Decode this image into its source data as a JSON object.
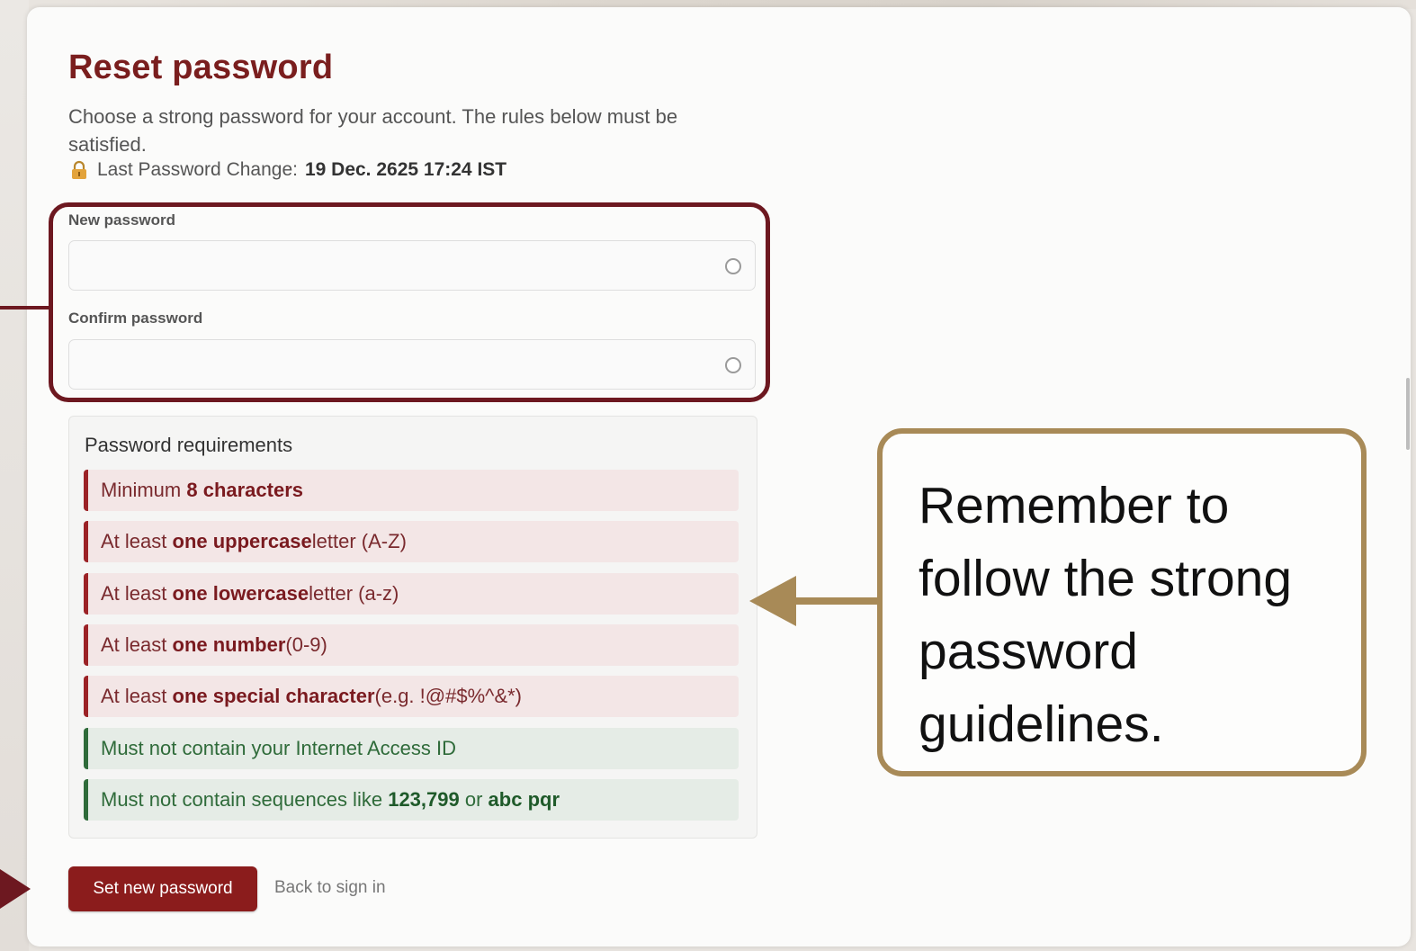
{
  "page": {
    "title": "Reset password",
    "subtitle": "Choose a strong password for your account. The rules below must be satisfied.",
    "last_change_label": "Last Password Change:",
    "last_change_value": "19 Dec. 2625 17:24 IST"
  },
  "form": {
    "new_password_label": "New password",
    "new_password_value": "",
    "confirm_password_label": "Confirm password",
    "confirm_password_value": ""
  },
  "requirements": {
    "heading": "Password requirements",
    "items": [
      {
        "status": "fail",
        "pre": "Minimum ",
        "bold": "8 characters",
        "post": ""
      },
      {
        "status": "fail",
        "pre": "At least ",
        "bold": "one uppercase",
        "post": " letter (A-Z)"
      },
      {
        "status": "fail",
        "pre": "At least ",
        "bold": "one lowercase",
        "post": " letter (a-z)"
      },
      {
        "status": "fail",
        "pre": "At least ",
        "bold": "one number",
        "post": " (0-9)"
      },
      {
        "status": "fail",
        "pre": "At least ",
        "bold": "one special character",
        "post": " (e.g. !@#$%^&*)"
      },
      {
        "status": "pass",
        "pre": "Must not contain your Internet Access ID",
        "bold": "",
        "post": ""
      },
      {
        "status": "pass",
        "pre": "Must not contain sequences like ",
        "bold": "123,799",
        "post": " or ",
        "bold2": "abc pqr"
      }
    ]
  },
  "actions": {
    "submit_label": "Set new password",
    "back_label": "Back to sign in"
  },
  "callout": {
    "text": "Remember to follow the strong password guidelines."
  },
  "icons": {
    "lock": "lock-icon",
    "eye": "eye-icon"
  },
  "colors": {
    "brand": "#7a1e1e",
    "button": "#8b1c1c",
    "fail_bg": "#f3e6e6",
    "pass_bg": "#e5ece6",
    "pass_text": "#2f6b3a",
    "callout_border": "#a88a57"
  }
}
